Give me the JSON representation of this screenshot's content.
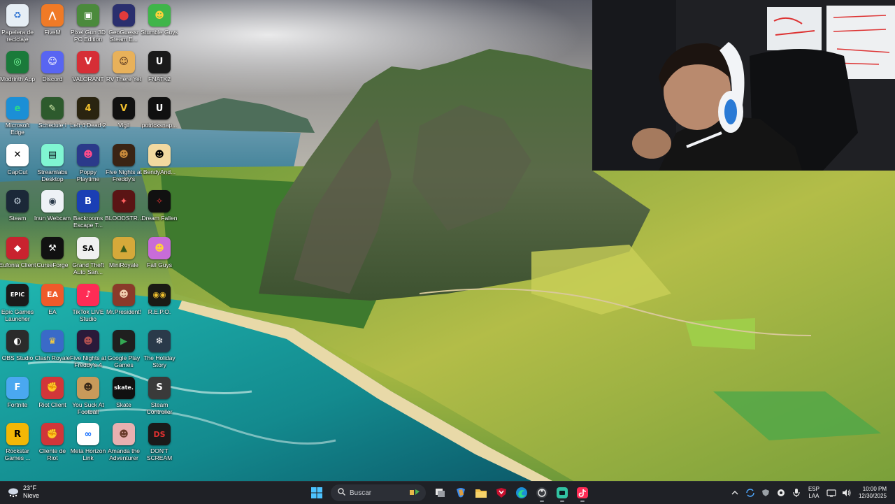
{
  "desktop": {
    "icons": [
      {
        "label": "Papelera de reciclaje",
        "icon": "recycle-bin-icon",
        "color": "#e6eef5",
        "glyph": "♻",
        "fg": "#3a7bd5"
      },
      {
        "label": "FiveM",
        "icon": "fivem-icon",
        "color": "#f07a26",
        "glyph": "⋀",
        "fg": "#fff"
      },
      {
        "label": "Pixel Gun 3D PC Edition",
        "icon": "pixel-gun-icon",
        "color": "#4b8a3c",
        "glyph": "▣",
        "fg": "#fff"
      },
      {
        "label": "GeoGuessr Steam E...",
        "icon": "geoguessr-icon",
        "color": "#2a2f6e",
        "glyph": "⬤",
        "fg": "#e23b3b"
      },
      {
        "label": "Stumble Guys",
        "icon": "stumble-guys-icon",
        "color": "#3fb54a",
        "glyph": "☻",
        "fg": "#ffd23a"
      },
      {
        "label": "Modrinth App",
        "icon": "modrinth-icon",
        "color": "#1a7a3a",
        "glyph": "◎",
        "fg": "#7dffa1"
      },
      {
        "label": "Discord",
        "icon": "discord-icon",
        "color": "#5865f2",
        "glyph": "☺",
        "fg": "#fff"
      },
      {
        "label": "VALORANT",
        "icon": "valorant-icon",
        "color": "#d62e36",
        "glyph": "V",
        "fg": "#fff"
      },
      {
        "label": "RV There Yet",
        "icon": "rv-there-yet-icon",
        "color": "#e8b15a",
        "glyph": "☺",
        "fg": "#4a2b1b"
      },
      {
        "label": "FNATK2",
        "icon": "unreal-icon",
        "color": "#1a1a1a",
        "glyph": "U",
        "fg": "#fff"
      },
      {
        "label": "Microsoft Edge",
        "icon": "edge-icon",
        "color": "#1b8fd6",
        "glyph": "e",
        "fg": "#2bd98a"
      },
      {
        "label": "Schedule I",
        "icon": "schedule-i-icon",
        "color": "#2d5a2d",
        "glyph": "✎",
        "fg": "#d8f0b0"
      },
      {
        "label": "Left 4 Dead 2",
        "icon": "left4dead-icon",
        "color": "#2a2410",
        "glyph": "4",
        "fg": "#f2c12e"
      },
      {
        "label": "Vigil",
        "icon": "vigil-icon",
        "color": "#111111",
        "glyph": "V",
        "fg": "#f2c12e"
      },
      {
        "label": "potricksnap...",
        "icon": "unreal-engine-icon",
        "color": "#101010",
        "glyph": "U",
        "fg": "#fff"
      },
      {
        "label": "CapCut",
        "icon": "capcut-icon",
        "color": "#ffffff",
        "glyph": "✕",
        "fg": "#000"
      },
      {
        "label": "Streamlabs Desktop",
        "icon": "streamlabs-icon",
        "color": "#80f5d2",
        "glyph": "▤",
        "fg": "#09161d"
      },
      {
        "label": "Poppy Playtime",
        "icon": "poppy-playtime-icon",
        "color": "#2b3a8a",
        "glyph": "☻",
        "fg": "#ff4b8a"
      },
      {
        "label": "Five Nights at Freddy's",
        "icon": "fnaf-icon",
        "color": "#3a2414",
        "glyph": "☻",
        "fg": "#c98a3b"
      },
      {
        "label": "BendyAnd...",
        "icon": "bendy-icon",
        "color": "#f2d9a0",
        "glyph": "☻",
        "fg": "#000"
      },
      {
        "label": "Steam",
        "icon": "steam-icon",
        "color": "#1b2838",
        "glyph": "⚙",
        "fg": "#c7d5e0"
      },
      {
        "label": "Inun Webcam",
        "icon": "webcam-icon",
        "color": "#eef2f6",
        "glyph": "◉",
        "fg": "#2a3a4a"
      },
      {
        "label": "Backrooms Escape T...",
        "icon": "backrooms-icon",
        "color": "#1a3fb5",
        "glyph": "B",
        "fg": "#fff"
      },
      {
        "label": "BLOODSTR...",
        "icon": "bloodstrike-icon",
        "color": "#5a1414",
        "glyph": "✦",
        "fg": "#ff6060"
      },
      {
        "label": "Dream Fallen",
        "icon": "dream-fallen-icon",
        "color": "#111",
        "glyph": "✧",
        "fg": "#d33"
      },
      {
        "label": "Eufonia Client",
        "icon": "eufonia-icon",
        "color": "#c9232f",
        "glyph": "◆",
        "fg": "#fff"
      },
      {
        "label": "CurseForge",
        "icon": "curseforge-icon",
        "color": "#111",
        "glyph": "⚒",
        "fg": "#fff"
      },
      {
        "label": "Grand Theft Auto San...",
        "icon": "gta-sa-icon",
        "color": "#f0f0f0",
        "glyph": "SA",
        "fg": "#000"
      },
      {
        "label": "MiniRoyale",
        "icon": "miniroyale-icon",
        "color": "#d6a93a",
        "glyph": "▲",
        "fg": "#3a5a1a"
      },
      {
        "label": "Fall Guys",
        "icon": "fall-guys-icon",
        "color": "#c86cd8",
        "glyph": "☻",
        "fg": "#ffd23a"
      },
      {
        "label": "Epic Games Launcher",
        "icon": "epic-games-icon",
        "color": "#1a1a1a",
        "glyph": "EPIC",
        "fg": "#fff"
      },
      {
        "label": "EA",
        "icon": "ea-icon",
        "color": "#ef5a2a",
        "glyph": "EA",
        "fg": "#fff"
      },
      {
        "label": "TikTok LIVE Studio",
        "icon": "tiktok-live-icon",
        "color": "#fe2c55",
        "glyph": "♪",
        "fg": "#fff"
      },
      {
        "label": "Mr.President!",
        "icon": "mr-president-icon",
        "color": "#8a3a2a",
        "glyph": "☻",
        "fg": "#f2d0b0"
      },
      {
        "label": "R.E.P.O.",
        "icon": "repo-icon",
        "color": "#1a1a14",
        "glyph": "◉◉",
        "fg": "#f2c12e"
      },
      {
        "label": "OBS Studio",
        "icon": "obs-icon",
        "color": "#2b2b2b",
        "glyph": "◐",
        "fg": "#fff"
      },
      {
        "label": "Clash Royale",
        "icon": "clash-royale-icon",
        "color": "#3a6ac8",
        "glyph": "♛",
        "fg": "#ffd23a"
      },
      {
        "label": "Five Nights at Freddy's 4",
        "icon": "fnaf4-icon",
        "color": "#2a1a3a",
        "glyph": "☻",
        "fg": "#b05050"
      },
      {
        "label": "Google Play Games",
        "icon": "google-play-games-icon",
        "color": "#1f1f1f",
        "glyph": "▶",
        "fg": "#34a853"
      },
      {
        "label": "The Holiday Story",
        "icon": "holiday-story-icon",
        "color": "#2a3a4a",
        "glyph": "❄",
        "fg": "#fff"
      },
      {
        "label": "Fortnite",
        "icon": "fortnite-icon",
        "color": "#4aa8f0",
        "glyph": "F",
        "fg": "#fff"
      },
      {
        "label": "Riot Client",
        "icon": "riot-client-icon",
        "color": "#d13639",
        "glyph": "✊",
        "fg": "#fff"
      },
      {
        "label": "You Suck At Football",
        "icon": "football-game-icon",
        "color": "#c89a5a",
        "glyph": "☻",
        "fg": "#3a2a1a"
      },
      {
        "label": "Skate",
        "icon": "skate-icon",
        "color": "#111",
        "glyph": "skate.",
        "fg": "#fff"
      },
      {
        "label": "Steam Controller",
        "icon": "steam-controller-icon",
        "color": "#3a3a3a",
        "glyph": "S",
        "fg": "#fff"
      },
      {
        "label": "Rockstar Games ...",
        "icon": "rockstar-icon",
        "color": "#f2b705",
        "glyph": "R",
        "fg": "#000"
      },
      {
        "label": "Cliente de Riot",
        "icon": "riot-client-2-icon",
        "color": "#d13639",
        "glyph": "✊",
        "fg": "#fff"
      },
      {
        "label": "Meta Horizon Link",
        "icon": "meta-horizon-icon",
        "color": "#ffffff",
        "glyph": "∞",
        "fg": "#0866ff"
      },
      {
        "label": "Amanda the Adventurer",
        "icon": "amanda-icon",
        "color": "#e8b0b0",
        "glyph": "☻",
        "fg": "#6a3a2a"
      },
      {
        "label": "DON'T SCREAM",
        "icon": "dont-scream-icon",
        "color": "#1a1a1a",
        "glyph": "DS",
        "fg": "#e03030"
      }
    ]
  },
  "taskbar": {
    "weather": {
      "temp": "23°F",
      "condition": "Nieve"
    },
    "search_placeholder": "Buscar",
    "lang_line1": "ESP",
    "lang_line2": "LAA",
    "time": "10:00 PM",
    "date": "12/30/2025"
  },
  "colors": {
    "taskbar_bg": "#1f2126",
    "windows_blue": "#0078d4",
    "accent": "#f07a26"
  }
}
